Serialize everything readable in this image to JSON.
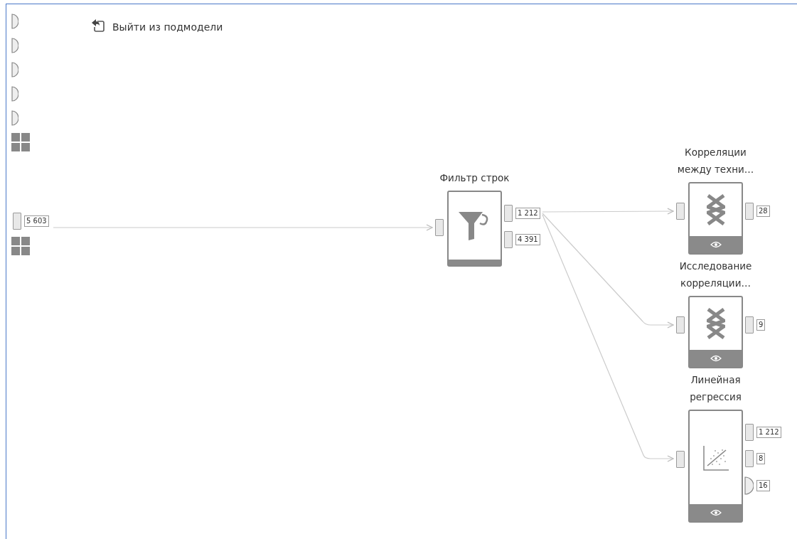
{
  "exit_link": {
    "label": "Выйти из подмодели"
  },
  "side_ports": [
    {
      "kind": "optional"
    },
    {
      "kind": "optional"
    },
    {
      "kind": "optional"
    },
    {
      "kind": "optional"
    },
    {
      "kind": "optional"
    },
    {
      "kind": "grid"
    },
    {
      "kind": "table",
      "count": "5 603"
    },
    {
      "kind": "grid"
    }
  ],
  "nodes": [
    {
      "title": "Фильтр строк",
      "kind": "filter",
      "viewable": false,
      "outputs": [
        {
          "kind": "table",
          "count": "1 212"
        },
        {
          "kind": "table",
          "count": "4 391"
        }
      ]
    },
    {
      "title": "Корреляции между техни…",
      "kind": "correlation",
      "viewable": true,
      "outputs": [
        {
          "kind": "table",
          "count": "28"
        }
      ]
    },
    {
      "title": "Исследование корреляции…",
      "kind": "correlation",
      "viewable": true,
      "outputs": [
        {
          "kind": "table",
          "count": "9"
        }
      ]
    },
    {
      "title": "Линейная регрессия",
      "kind": "regression",
      "viewable": true,
      "outputs": [
        {
          "kind": "table",
          "count": "1 212"
        },
        {
          "kind": "table",
          "count": "8"
        },
        {
          "kind": "optional",
          "count": "16"
        }
      ]
    }
  ]
}
